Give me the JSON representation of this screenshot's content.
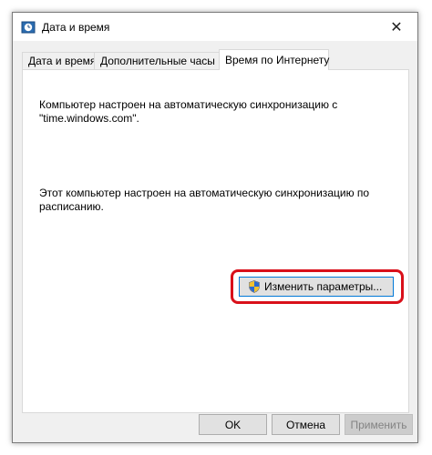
{
  "window": {
    "title": "Дата и время",
    "close_glyph": "✕"
  },
  "tabs": [
    {
      "label": "Дата и время",
      "active": false
    },
    {
      "label": "Дополнительные часы",
      "active": false
    },
    {
      "label": "Время по Интернету",
      "active": true
    }
  ],
  "panel": {
    "sync_server_text_line1": "Компьютер настроен на автоматическую синхронизацию с",
    "sync_server_text_line2": "\"time.windows.com\".",
    "schedule_text_line1": "Этот компьютер настроен на автоматическую синхронизацию по",
    "schedule_text_line2": "расписанию.",
    "change_settings_label": "Изменить параметры..."
  },
  "footer": {
    "ok_label": "OK",
    "cancel_label": "Отмена",
    "apply_label": "Применить"
  },
  "colors": {
    "highlight": "#d9101a",
    "focus_border": "#0078d7"
  },
  "icons": {
    "app": "clock-icon",
    "close": "close-icon",
    "shield": "uac-shield-icon"
  }
}
